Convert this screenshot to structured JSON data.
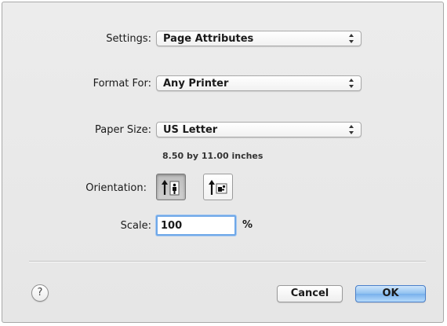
{
  "dialog": {
    "settings": {
      "label": "Settings:",
      "value": "Page Attributes"
    },
    "format_for": {
      "label": "Format For:",
      "value": "Any Printer"
    },
    "paper_size": {
      "label": "Paper Size:",
      "value": "US Letter",
      "dimensions": "8.50 by 11.00 inches"
    },
    "orientation": {
      "label": "Orientation:",
      "options": [
        {
          "name": "portrait",
          "selected": true
        },
        {
          "name": "landscape",
          "selected": false
        }
      ]
    },
    "scale": {
      "label": "Scale:",
      "value": "100",
      "unit": "%"
    },
    "buttons": {
      "help": "?",
      "cancel": "Cancel",
      "ok": "OK"
    }
  },
  "colors": {
    "default_button_blue": "#78b0ec",
    "focus_ring": "#6fa8e8",
    "background": "#ececec"
  },
  "icons": {
    "popup": "up-down-arrows-icon",
    "portrait": "portrait-orientation-icon",
    "landscape": "landscape-orientation-icon",
    "help": "help-icon"
  }
}
